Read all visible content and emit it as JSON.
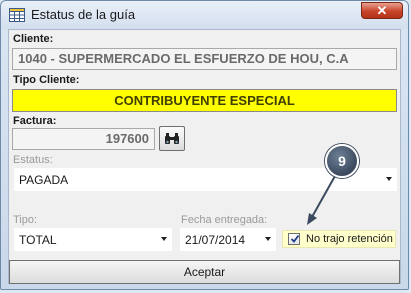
{
  "window": {
    "title": "Estatus de la guía",
    "close_glyph": "✕"
  },
  "cliente": {
    "label": "Cliente:",
    "value": "1040 - SUPERMERCADO EL ESFUERZO DE HOU, C.A"
  },
  "tipo_cliente": {
    "label": "Tipo Cliente:",
    "value": "CONTRIBUYENTE ESPECIAL",
    "highlight_color": "#ffff00"
  },
  "factura": {
    "label": "Factura:",
    "value": "197600",
    "search_icon": "binoculars-icon"
  },
  "estatus": {
    "label": "Estatus:",
    "value": "PAGADA"
  },
  "tipo": {
    "label": "Tipo:",
    "value": "TOTAL"
  },
  "fecha_entregada": {
    "label": "Fecha entregada:",
    "value": "21/07/2014"
  },
  "no_trajo_retencion": {
    "label": "No trajo retención",
    "checked": true
  },
  "accept_button": {
    "label": "Aceptar"
  },
  "callout": {
    "number": "9"
  }
}
